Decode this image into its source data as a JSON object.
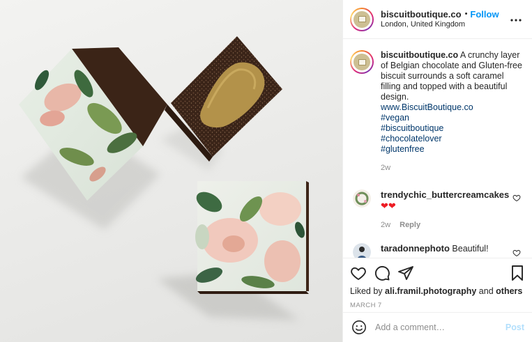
{
  "post": {
    "username": "biscuitboutique.co",
    "follow_label": "Follow",
    "separator": "•",
    "location": "London, United Kingdom",
    "more_icon": "more-horizontal-icon",
    "image_alt": "Floral printed chocolate biscuit bars"
  },
  "caption": {
    "username": "biscuitboutique.co",
    "text": "A crunchy layer of Belgian chocolate and Gluten-free biscuit surrounds a soft caramel filling and topped with a beautiful design.",
    "link": "www.BiscuitBoutique.co",
    "hashtags": [
      "#vegan",
      "#biscuitboutique",
      "#chocolatelover",
      "#glutenfree"
    ],
    "age": "2w"
  },
  "comments": [
    {
      "username": "trendychic_buttercreamcakes",
      "text": "❤❤",
      "age": "2w",
      "reply_label": "Reply"
    },
    {
      "username": "taradonnephoto",
      "text": "Beautiful!"
    }
  ],
  "actions": {
    "icons": [
      "heart-icon",
      "comment-icon",
      "share-icon",
      "bookmark-icon"
    ],
    "liked_by_prefix": "Liked by",
    "liked_by_user": "ali.framil.photography",
    "liked_by_and": "and",
    "liked_by_others": "others",
    "date": "MARCH 7"
  },
  "add_comment": {
    "placeholder": "Add a comment…",
    "post_label": "Post"
  },
  "colors": {
    "link_blue": "#0095f6",
    "hashtag": "#00376b",
    "muted": "#8e8e8e",
    "heart_red": "#ed1c24",
    "post_disabled": "#b2dffc"
  }
}
